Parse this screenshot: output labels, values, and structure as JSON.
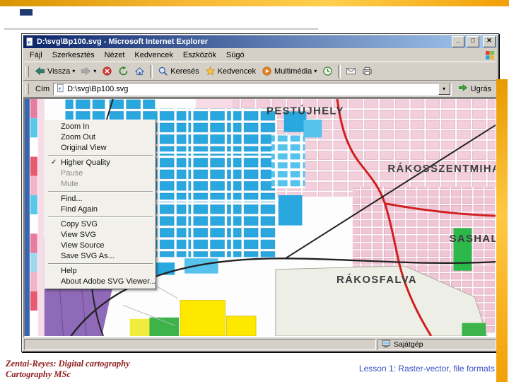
{
  "slide": {
    "footer_left_line1": "Zentai-Reyes: Digital cartography",
    "footer_left_line2": "Cartography MSc",
    "footer_right": "Lesson 1: Raster-vector, file formats"
  },
  "window": {
    "title": "D:\\svg\\Bp100.svg - Microsoft Internet Explorer",
    "controls": {
      "minimize": "_",
      "maximize": "□",
      "close": "✕"
    },
    "menu": [
      "Fájl",
      "Szerkesztés",
      "Nézet",
      "Kedvencek",
      "Eszközök",
      "Súgó"
    ],
    "toolbar": {
      "back": "Vissza",
      "search": "Keresés",
      "favorites": "Kedvencek",
      "media": "Multimédia"
    },
    "address": {
      "label": "Cím",
      "value": "D:\\svg\\Bp100.svg",
      "go": "Ugrás"
    },
    "status_zone": "Sajátgép"
  },
  "context_menu": {
    "items": [
      {
        "label": "Zoom In",
        "state": "normal"
      },
      {
        "label": "Zoom Out",
        "state": "normal"
      },
      {
        "label": "Original View",
        "state": "normal"
      },
      {
        "label": "Higher Quality",
        "state": "checked"
      },
      {
        "label": "Pause",
        "state": "disabled"
      },
      {
        "label": "Mute",
        "state": "disabled"
      },
      {
        "label": "Find...",
        "state": "normal"
      },
      {
        "label": "Find Again",
        "state": "normal"
      },
      {
        "label": "Copy SVG",
        "state": "normal"
      },
      {
        "label": "View SVG",
        "state": "normal"
      },
      {
        "label": "View Source",
        "state": "normal"
      },
      {
        "label": "Save SVG As...",
        "state": "normal"
      },
      {
        "label": "Help",
        "state": "normal"
      },
      {
        "label": "About Adobe SVG Viewer...",
        "state": "normal"
      }
    ]
  },
  "map": {
    "labels": {
      "pestujhely": "PESTÚJHELY",
      "rakosszentmihaly": "RÁKOSSZENTMIHÁLY",
      "sashalom": "SASHALOM",
      "rakosfalva": "RÁKOSFALVA"
    }
  },
  "icons": {
    "dropdown": "▾",
    "check": "✓"
  },
  "colors": {
    "accent_orange": "#F2A007",
    "titlebar_left": "#0A246A",
    "titlebar_right": "#A6CAF0",
    "boundary_red": "#CF1F1F",
    "footer_left_text": "#8E1B1B",
    "footer_right_text": "#3A50C2"
  }
}
